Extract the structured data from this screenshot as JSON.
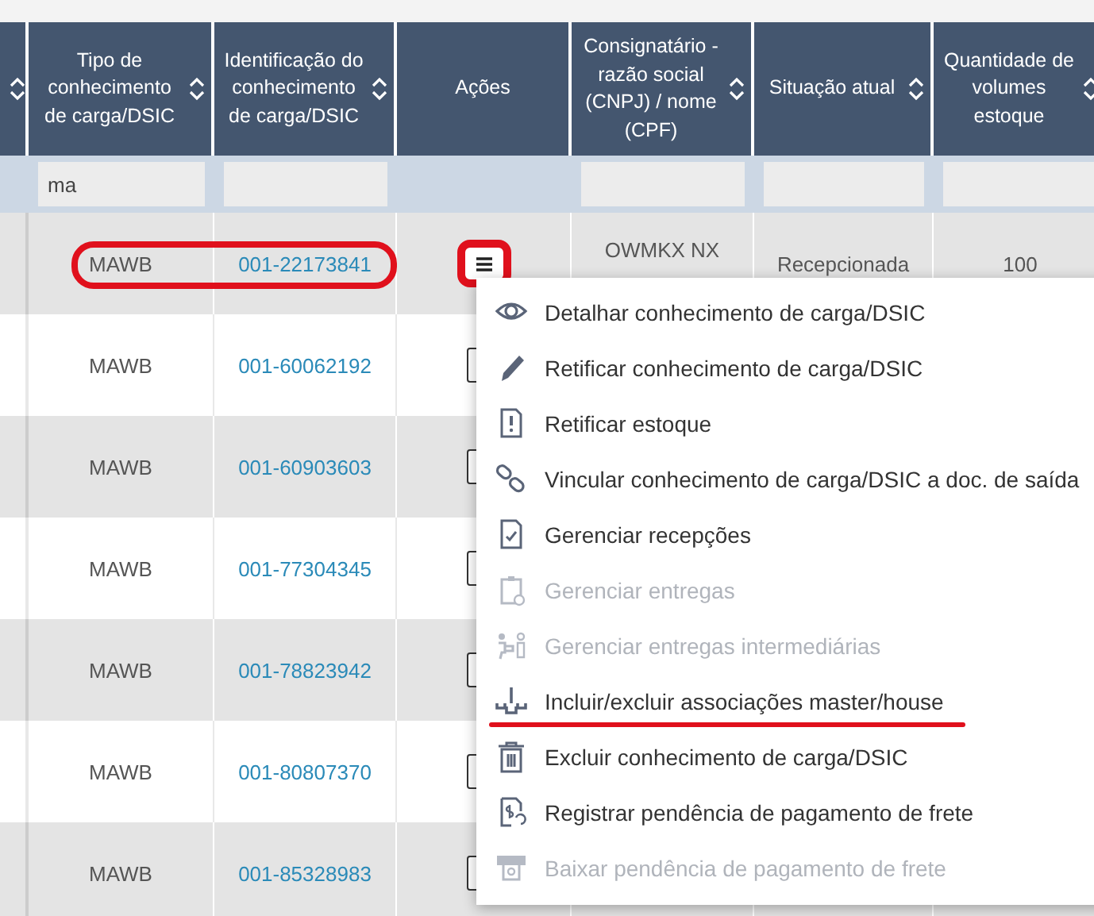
{
  "columns": [
    {
      "sortable": true
    },
    {
      "label": "Tipo de conhecimento de carga/DSIC",
      "sortable": true
    },
    {
      "label": "Identificação do conhecimento de carga/DSIC",
      "sortable": true
    },
    {
      "label": "Ações",
      "sortable": false
    },
    {
      "label": "Consignatário - razão social (CNPJ) / nome (CPF)",
      "sortable": true
    },
    {
      "label": "Situação atual",
      "sortable": true
    },
    {
      "label": "Quantidade de volumes estoque",
      "sortable": true
    }
  ],
  "filters": [
    {
      "kind": "none"
    },
    {
      "kind": "input",
      "value": "ma"
    },
    {
      "kind": "input"
    },
    {
      "kind": "none"
    },
    {
      "kind": "input"
    },
    {
      "kind": "input"
    },
    {
      "kind": "input"
    }
  ],
  "rows": [
    {
      "type": "MAWB",
      "id": "001-22173841",
      "consignee": "OWMKX NX",
      "status": "Recepcionada",
      "quantity": "100",
      "highlighted": true,
      "menu_open": true
    },
    {
      "type": "MAWB",
      "id": "001-60062192",
      "highlighted": false,
      "menu_open": false
    },
    {
      "type": "MAWB",
      "id": "001-60903603",
      "highlighted": false,
      "menu_open": false
    },
    {
      "type": "MAWB",
      "id": "001-77304345",
      "highlighted": false,
      "menu_open": false
    },
    {
      "type": "MAWB",
      "id": "001-78823942",
      "highlighted": false,
      "menu_open": false
    },
    {
      "type": "MAWB",
      "id": "001-80807370",
      "highlighted": false,
      "menu_open": false
    },
    {
      "type": "MAWB",
      "id": "001-85328983",
      "highlighted": false,
      "menu_open": false
    }
  ],
  "menu": [
    {
      "label": "Detalhar conhecimento de carga/DSIC",
      "kind": "eye",
      "disabled": false,
      "underlined": false
    },
    {
      "label": "Retificar conhecimento de carga/DSIC",
      "kind": "pencil",
      "disabled": false,
      "underlined": false
    },
    {
      "label": "Retificar estoque",
      "kind": "alert-doc",
      "disabled": false,
      "underlined": false
    },
    {
      "label": "Vincular conhecimento de carga/DSIC a doc. de saída",
      "kind": "link",
      "disabled": false,
      "underlined": false
    },
    {
      "label": "Gerenciar recepções",
      "kind": "check-doc",
      "disabled": false,
      "underlined": false
    },
    {
      "label": "Gerenciar entregas",
      "kind": "clipboard",
      "disabled": true,
      "underlined": false
    },
    {
      "label": "Gerenciar entregas intermediárias",
      "kind": "people",
      "disabled": true,
      "underlined": false
    },
    {
      "label": "Incluir/excluir associações master/house",
      "kind": "hierarchy",
      "disabled": false,
      "underlined": true
    },
    {
      "label": "Excluir conhecimento de carga/DSIC",
      "kind": "trash",
      "disabled": false,
      "underlined": false
    },
    {
      "label": "Registrar pendência de pagamento de frete",
      "kind": "dollar-doc",
      "disabled": false,
      "underlined": false
    },
    {
      "label": "Baixar pendência de pagamento de frete",
      "kind": "printer",
      "disabled": true,
      "underlined": false
    }
  ]
}
